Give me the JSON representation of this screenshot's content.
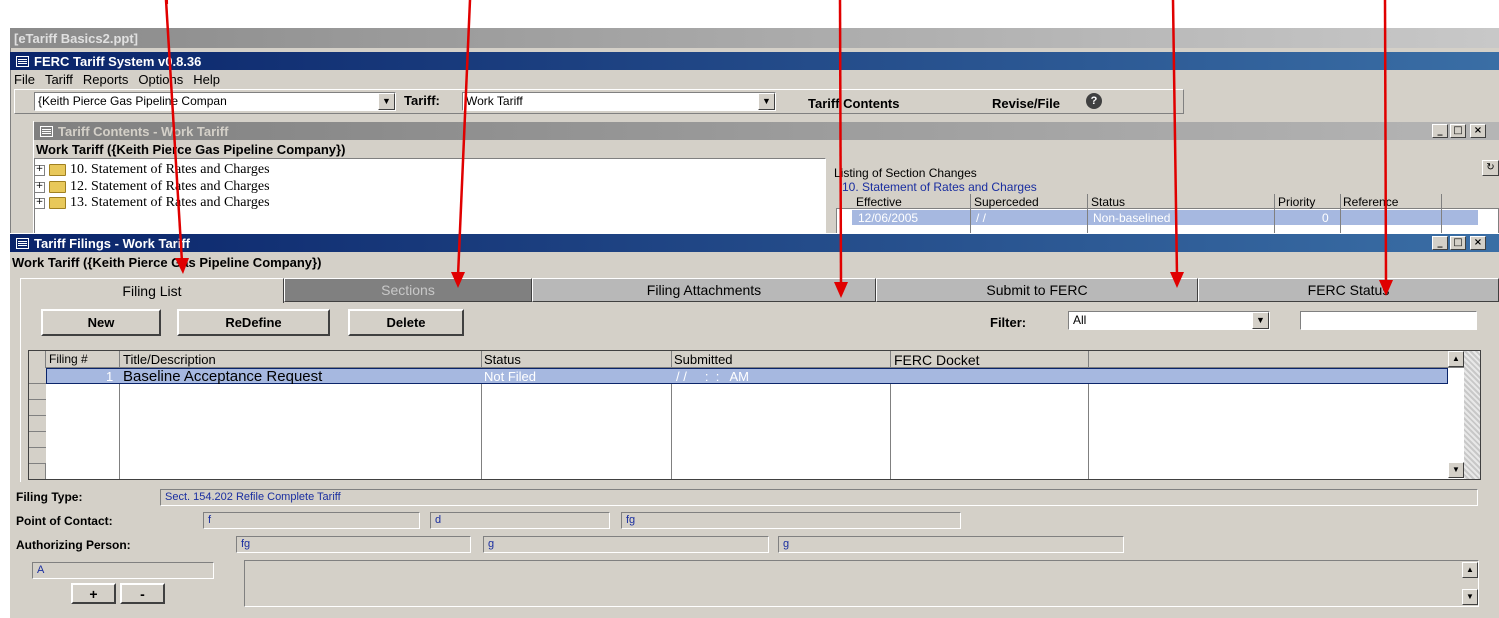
{
  "ppt_title": "[eTariff Basics2.ppt]",
  "app": {
    "title": "FERC Tariff System v0.8.36",
    "menu": [
      "File",
      "Tariff",
      "Reports",
      "Options",
      "Help"
    ]
  },
  "toolbar": {
    "company_value": "{Keith Pierce Gas Pipeline Compan",
    "tariff_label": "Tariff:",
    "tariff_value": "Work Tariff",
    "tariff_contents_label": "Tariff Contents",
    "revise_file_label": "Revise/File"
  },
  "contents_window": {
    "title": "Tariff Contents - Work Tariff",
    "subtitle": "Work Tariff ({Keith Pierce Gas Pipeline Company})",
    "tree": [
      "10. Statement of Rates and Charges",
      "12. Statement of Rates and Charges",
      "13. Statement of Rates and Charges"
    ],
    "listing_label": "Listing of Section Changes",
    "section_label": "10. Statement of Rates and Charges",
    "columns": [
      "Effective",
      "Superceded",
      "Status",
      "Priority",
      "Reference"
    ],
    "row": {
      "effective": "12/06/2005",
      "superceded": "/ /",
      "status": "Non-baselined",
      "priority": "0",
      "reference": ""
    }
  },
  "filings_window": {
    "title": "Tariff Filings - Work Tariff",
    "subtitle": "Work Tariff ({Keith Pierce Gas Pipeline Company})",
    "tabs": [
      "Filing List",
      "Sections",
      "Filing Attachments",
      "Submit to FERC",
      "FERC Status"
    ],
    "buttons": {
      "new": "New",
      "redefine": "ReDefine",
      "delete": "Delete"
    },
    "filter_label": "Filter:",
    "filter_value": "All",
    "filter_search": "",
    "grid_columns": [
      "Filing #",
      "Title/Description",
      "Status",
      "Submitted",
      "FERC Docket"
    ],
    "grid_row": {
      "number": "1",
      "title": "Baseline Acceptance Request",
      "status": "Not Filed",
      "submitted": "/ /     :  :   AM",
      "docket": ""
    },
    "filing_type_label": "Filing Type:",
    "filing_type_value": "Sect. 154.202 Refile Complete Tariff",
    "contact_label": "Point of Contact:",
    "contact_values": [
      "f",
      "d",
      "fg"
    ],
    "auth_label": "Authorizing Person:",
    "auth_values": [
      "fg",
      "g",
      "g"
    ],
    "list_value": "A",
    "plus_label": "+",
    "minus_label": "-"
  },
  "colors": {
    "annotation_arrow": "#e00000",
    "active_title": "#0a246a",
    "selected_row": "#a6b8e0",
    "field_text": "#1a2ea0"
  }
}
